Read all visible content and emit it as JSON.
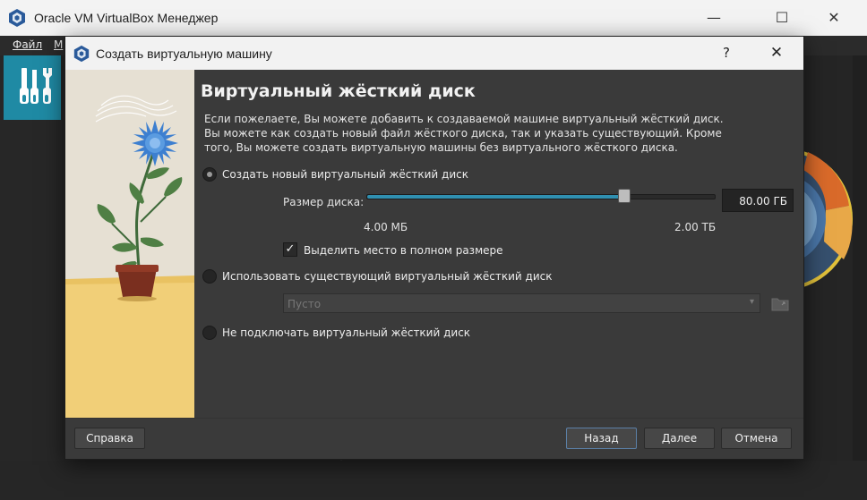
{
  "manager": {
    "title": "Oracle VM VirtualBox Менеджер",
    "menu": [
      "Файл",
      "М"
    ],
    "window_controls": {
      "minimize": "—",
      "maximize": "☐",
      "close": "✕"
    }
  },
  "dialog": {
    "title": "Создать виртуальную машину",
    "help_label": "?",
    "close_label": "✕",
    "heading": "Виртуальный жёсткий диск",
    "description": "Если пожелаете, Вы можете добавить к создаваемой машине виртуальный жёсткий диск. Вы можете как создать новый файл жёсткого диска, так и указать существующий. Кроме того, Вы можете создать виртуальную машины без виртуального жёсткого диска.",
    "options": {
      "create_new": {
        "label": "Создать новый виртуальный жёсткий диск",
        "selected": true
      },
      "use_existing": {
        "label": "Использовать существующий виртуальный жёсткий диск",
        "selected": false
      },
      "no_disk": {
        "label": "Не подключать виртуальный жёсткий диск",
        "selected": false
      }
    },
    "disk_size": {
      "label": "Размер диска:",
      "value": "80.00 ГБ",
      "min_label": "4.00 МБ",
      "max_label": "2.00 ТБ",
      "slider_fraction": 0.74
    },
    "preallocate": {
      "label": "Выделить место в полном размере",
      "checked": true,
      "mark": "✓"
    },
    "existing_disk_select": {
      "value": "Пусто",
      "arrow": "▾"
    },
    "buttons": {
      "help": "Справка",
      "back": "Назад",
      "next": "Далее",
      "cancel": "Отмена"
    }
  },
  "colors": {
    "accent": "#2f8fb0",
    "dialog_bg": "#3a3a3a",
    "tools_tile": "#1f8aa4"
  }
}
